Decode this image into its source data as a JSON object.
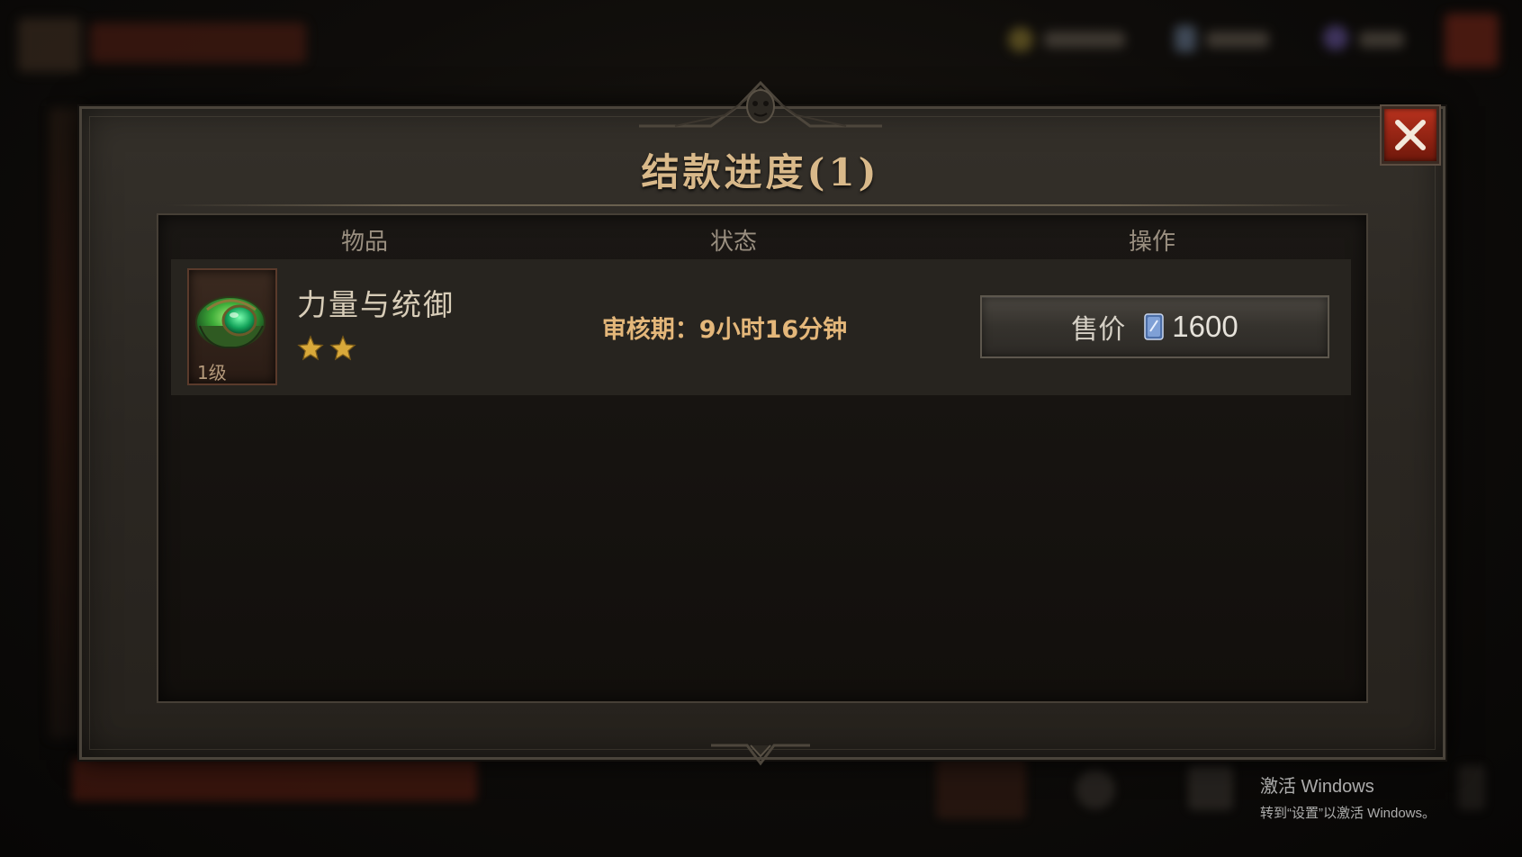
{
  "dialog": {
    "title": "结款进度(1)"
  },
  "table": {
    "columns": [
      "物品",
      "状态",
      "操作"
    ],
    "rows": [
      {
        "item_name": "力量与统御",
        "item_level": "1级",
        "stars": 2,
        "status": "审核期：9小时16分钟",
        "price_label": "售价",
        "price_value": "1600"
      }
    ]
  },
  "icons": {
    "close": "close-icon",
    "star": "star-icon",
    "currency": "platinum-card-icon",
    "item": "green-gem-helm-icon"
  },
  "watermark": {
    "line1": "激活 Windows",
    "line2": "转到“设置”以激活 Windows。"
  },
  "colors": {
    "title": "#d9b98a",
    "status": "#e4b77a",
    "close_button": "#b8321e",
    "star": "#d9a93a"
  }
}
